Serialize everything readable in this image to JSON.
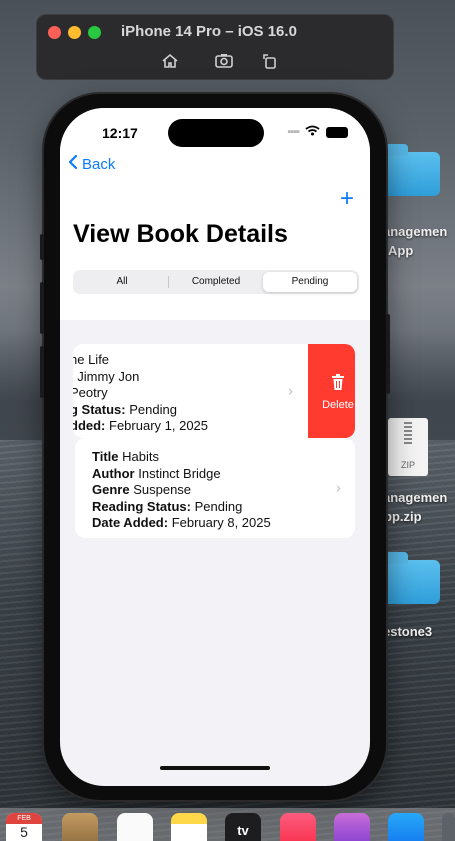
{
  "simulator": {
    "title": "iPhone 14 Pro – iOS 16.0",
    "tools": [
      "home-icon",
      "screenshot-icon",
      "rotate-icon"
    ]
  },
  "desktop": {
    "item1_label_line1": "anagemen",
    "item1_label_line2": "App",
    "zip_badge": "ZIP",
    "item2_label_line1": "anagemen",
    "item2_label_line2": "pp.zip",
    "item3_label": "estone3"
  },
  "status_bar": {
    "time": "12:17"
  },
  "nav": {
    "back_label": "Back",
    "add_label": "+"
  },
  "page": {
    "title": "View Book Details"
  },
  "segments": {
    "items": [
      "All",
      "Completed",
      "Pending"
    ],
    "selected": "Pending"
  },
  "books": [
    {
      "title_value": "he Life",
      "author_value": "Jimmy Jon",
      "genre_value": "Peotry",
      "status_label": "g Status:",
      "status_value": "Pending",
      "date_label": "dded:",
      "date_value": "February 1, 2025"
    },
    {
      "title_label": "Title",
      "title_value": "Habits",
      "author_label": "Author",
      "author_value": "Instinct Bridge",
      "genre_label": "Genre",
      "genre_value": "Suspense",
      "status_label": "Reading Status:",
      "status_value": "Pending",
      "date_label": "Date Added:",
      "date_value": "February 8, 2025"
    }
  ],
  "swipe_action": {
    "label": "Delete",
    "color": "#ff3b30"
  },
  "dock": {
    "calendar_month": "FEB",
    "calendar_day": "5",
    "tv_label": "tv"
  },
  "colors": {
    "accent": "#0a7aff",
    "delete": "#ff3b30"
  }
}
